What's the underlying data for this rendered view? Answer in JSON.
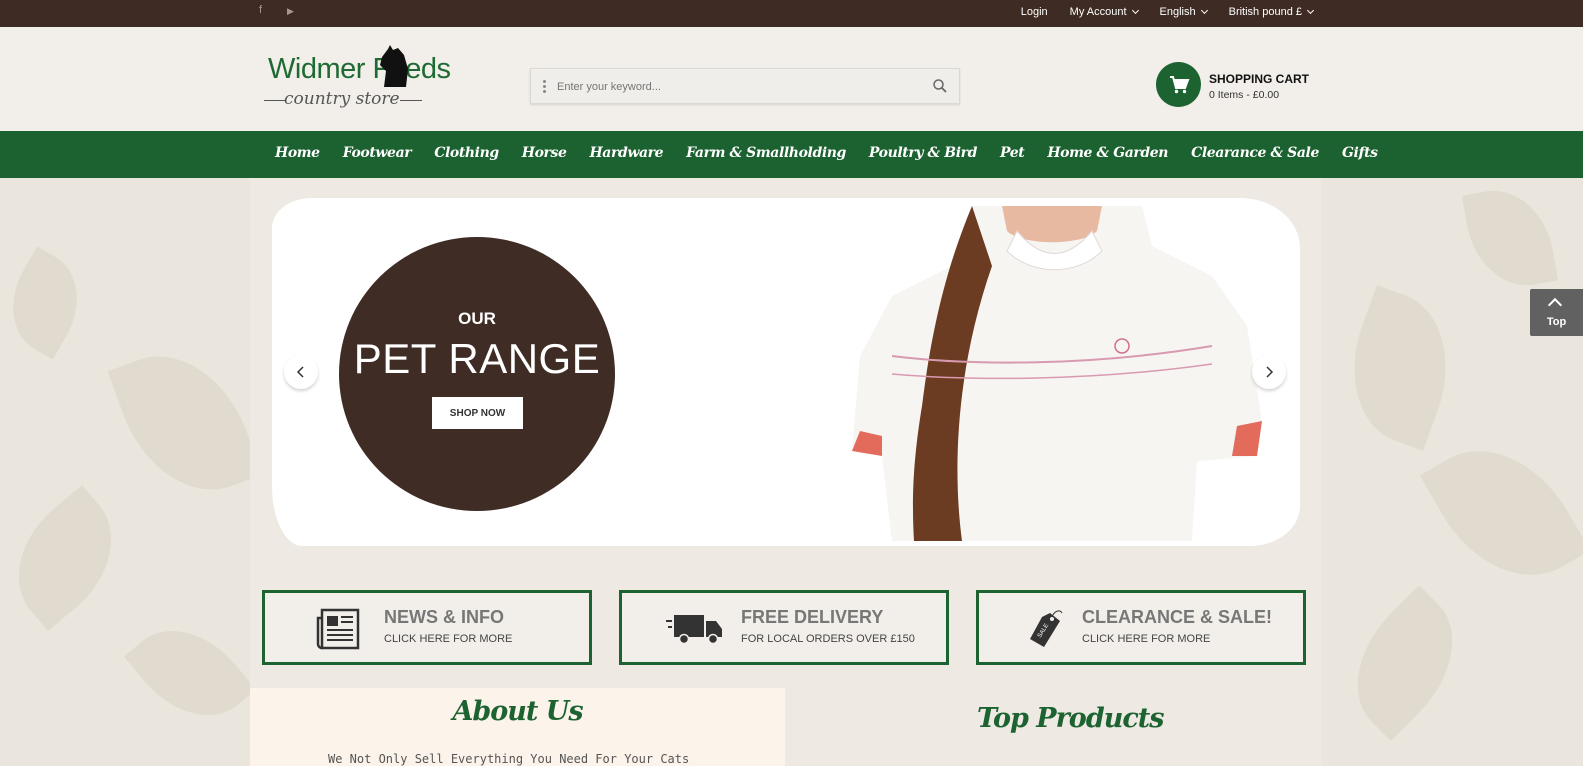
{
  "topbar": {
    "social": [
      {
        "name": "facebook-icon",
        "glyph": "f"
      },
      {
        "name": "youtube-icon",
        "glyph": "▶"
      }
    ],
    "login": "Login",
    "account": "My Account",
    "language": "English",
    "currency": "British pound £"
  },
  "header": {
    "logo_main": "Widmer Feeds",
    "logo_sub": "country store",
    "search_placeholder": "Enter your keyword...",
    "cart_title": "SHOPPING CART",
    "cart_summary": "0 Items - £0.00"
  },
  "nav": {
    "items": [
      "Home",
      "Footwear",
      "Clothing",
      "Horse",
      "Hardware",
      "Farm & Smallholding",
      "Poultry & Bird",
      "Pet",
      "Home & Garden",
      "Clearance & Sale",
      "Gifts"
    ]
  },
  "hero": {
    "eyebrow": "OUR",
    "headline": "PET RANGE",
    "cta": "SHOP NOW"
  },
  "features": [
    {
      "title": "NEWS & INFO",
      "subtitle": "CLICK HERE FOR MORE",
      "icon": "newspaper-icon"
    },
    {
      "title": "FREE DELIVERY",
      "subtitle": "FOR LOCAL ORDERS OVER £150",
      "icon": "truck-icon"
    },
    {
      "title": "CLEARANCE & SALE!",
      "subtitle": "CLICK HERE FOR MORE",
      "icon": "sale-tag-icon"
    }
  ],
  "sections": {
    "about_title": "About Us",
    "about_text": "We Not Only Sell Everything You Need For Your Cats",
    "top_products_title": "Top Products"
  },
  "back_to_top": "Top",
  "colors": {
    "brand_green": "#1c6130",
    "topbar_brown": "#3e2c24",
    "hero_circle": "#3f2c25"
  }
}
